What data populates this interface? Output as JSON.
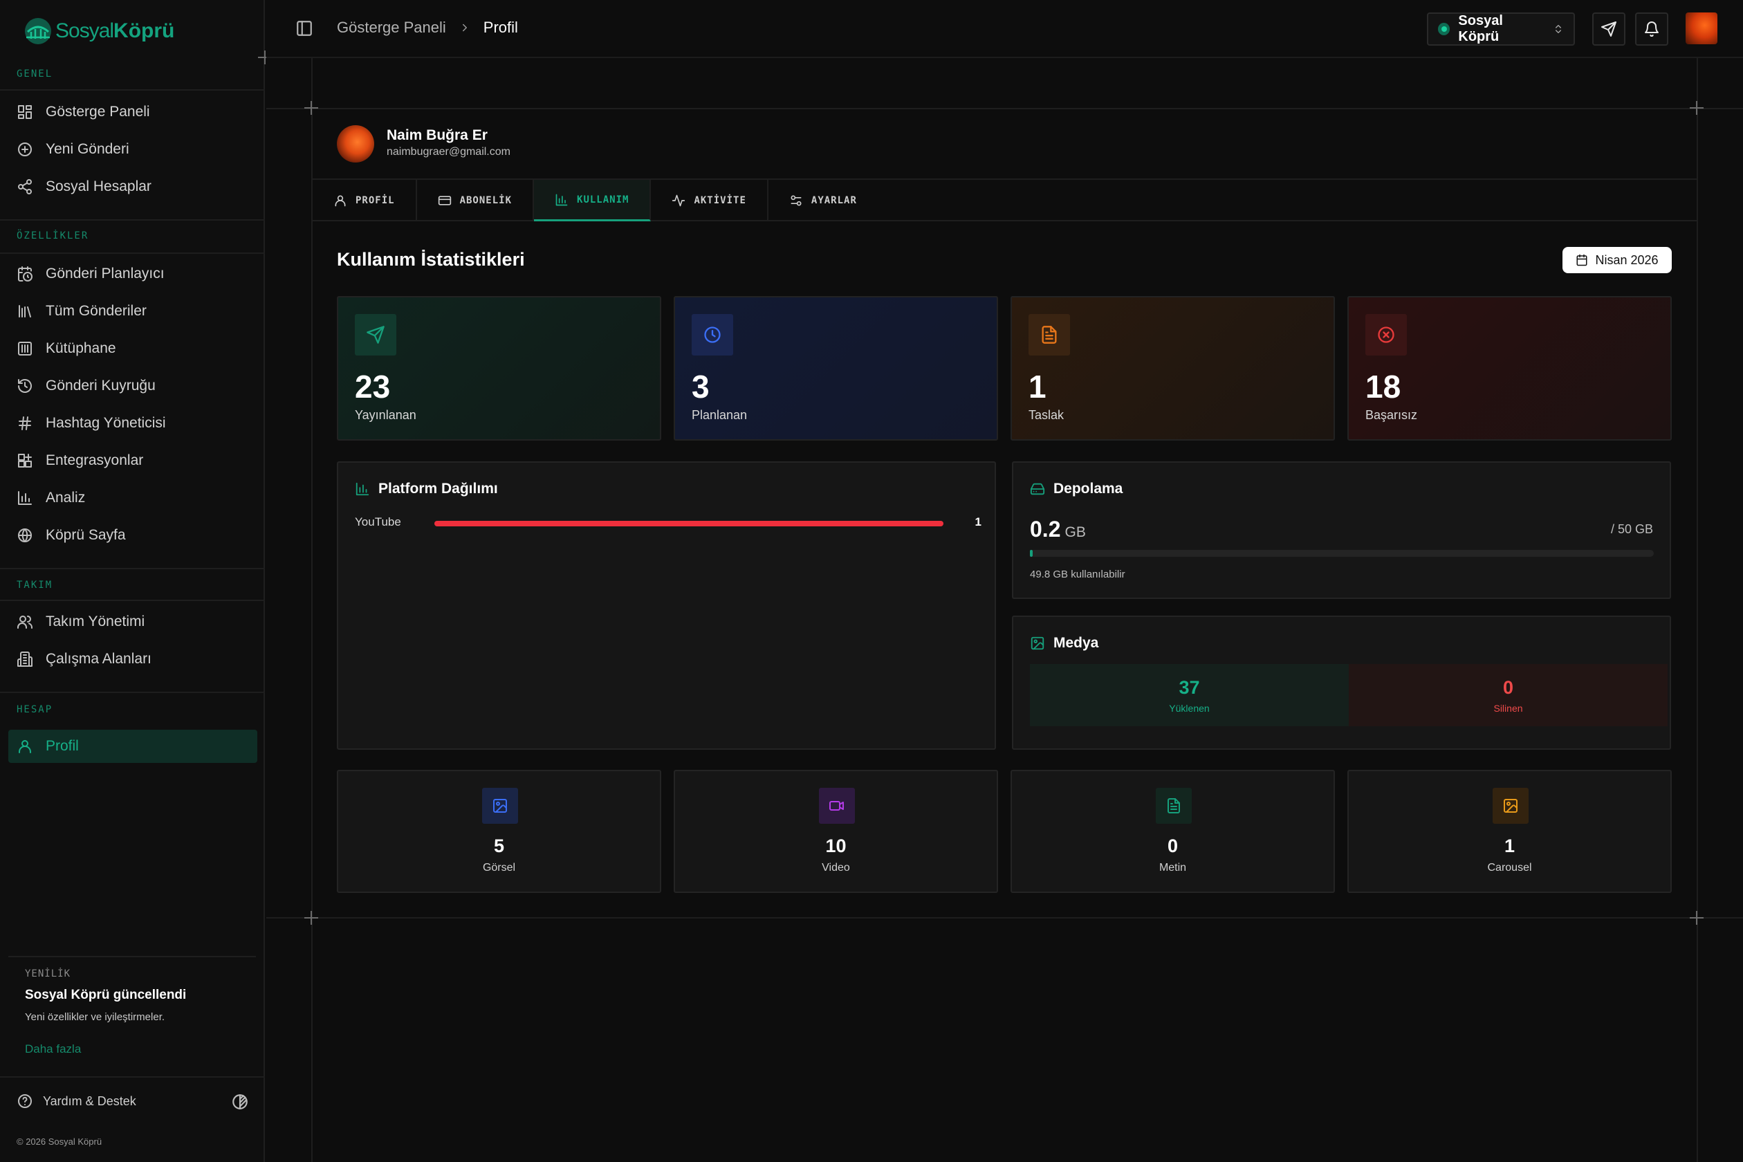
{
  "app": {
    "logo_text_light": "Sosyal",
    "logo_text_bold": "Köprü"
  },
  "sidebar": {
    "sections": [
      {
        "label": "GENEL",
        "items": [
          {
            "label": "Gösterge Paneli",
            "icon": "dashboard-icon"
          },
          {
            "label": "Yeni Gönderi",
            "icon": "plus-circle-icon"
          },
          {
            "label": "Sosyal Hesaplar",
            "icon": "share-icon"
          }
        ]
      },
      {
        "label": "ÖZELLİKLER",
        "items": [
          {
            "label": "Gönderi Planlayıcı",
            "icon": "calendar-clock-icon"
          },
          {
            "label": "Tüm Gönderiler",
            "icon": "library-icon"
          },
          {
            "label": "Kütüphane",
            "icon": "archive-icon"
          },
          {
            "label": "Gönderi Kuyruğu",
            "icon": "queue-icon"
          },
          {
            "label": "Hashtag Yöneticisi",
            "icon": "hash-icon"
          },
          {
            "label": "Entegrasyonlar",
            "icon": "integrations-icon"
          },
          {
            "label": "Analiz",
            "icon": "bar-chart-icon"
          },
          {
            "label": "Köprü Sayfa",
            "icon": "globe-icon"
          }
        ]
      },
      {
        "label": "TAKIM",
        "items": [
          {
            "label": "Takım Yönetimi",
            "icon": "users-icon"
          },
          {
            "label": "Çalışma Alanları",
            "icon": "building-icon"
          }
        ]
      },
      {
        "label": "HESAP",
        "items": [
          {
            "label": "Profil",
            "icon": "user-icon",
            "active": true
          }
        ]
      }
    ],
    "news": {
      "tag": "YENİLİK",
      "title": "Sosyal Köprü güncellendi",
      "description": "Yeni özellikler ve iyileştirmeler.",
      "link": "Daha fazla"
    },
    "help_label": "Yardım & Destek",
    "copyright": "© 2026 Sosyal Köprü"
  },
  "header": {
    "breadcrumb_parent": "Gösterge Paneli",
    "breadcrumb_current": "Profil",
    "workspace": "Sosyal Köprü"
  },
  "profile": {
    "name": "Naim Buğra Er",
    "email": "naimbugraer@gmail.com",
    "tabs": [
      {
        "label": "PROFİL",
        "icon": "user-icon"
      },
      {
        "label": "ABONELİK",
        "icon": "credit-card-icon"
      },
      {
        "label": "KULLANIM",
        "icon": "bar-chart-icon",
        "active": true
      },
      {
        "label": "AKTİVİTE",
        "icon": "activity-icon"
      },
      {
        "label": "AYARLAR",
        "icon": "sliders-icon"
      }
    ]
  },
  "usage": {
    "title": "Kullanım İstatistikleri",
    "period": "Nisan 2026",
    "stats": [
      {
        "value": "23",
        "label": "Yayınlanan",
        "icon": "send-icon",
        "color": "#16a07c"
      },
      {
        "value": "3",
        "label": "Planlanan",
        "icon": "clock-icon",
        "color": "#3b6ef5"
      },
      {
        "value": "1",
        "label": "Taslak",
        "icon": "file-text-icon",
        "color": "#e8761a"
      },
      {
        "value": "18",
        "label": "Başarısız",
        "icon": "x-circle-icon",
        "color": "#e83b3b"
      }
    ],
    "platform": {
      "title": "Platform Dağılımı",
      "rows": [
        {
          "label": "YouTube",
          "value": "1",
          "share": 1.0,
          "color": "#ef2f3c"
        }
      ]
    },
    "storage": {
      "title": "Depolama",
      "used": "0.2",
      "unit": "GB",
      "total": "/ 50 GB",
      "used_fraction": 0.004,
      "free_text": "49.8 GB kullanılabilir"
    },
    "media": {
      "title": "Medya",
      "uploaded_value": "37",
      "uploaded_label": "Yüklenen",
      "deleted_value": "0",
      "deleted_label": "Silinen"
    },
    "types": [
      {
        "value": "5",
        "label": "Görsel",
        "icon": "image-icon",
        "color": "#3b6ef5"
      },
      {
        "value": "10",
        "label": "Video",
        "icon": "video-icon",
        "color": "#b43be8"
      },
      {
        "value": "0",
        "label": "Metin",
        "icon": "file-text-icon",
        "color": "#16a07c"
      },
      {
        "value": "1",
        "label": "Carousel",
        "icon": "images-icon",
        "color": "#e89a1a"
      }
    ]
  }
}
